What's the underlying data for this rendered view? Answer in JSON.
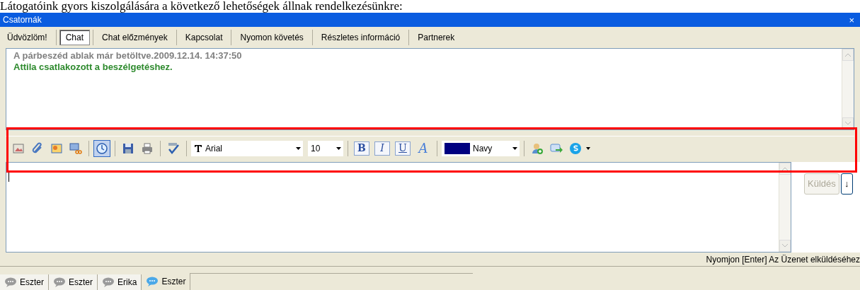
{
  "caption": "Látogatóink gyors kiszolgálására a következő lehetőségek állnak rendelkezésünkre:",
  "window": {
    "title": "Csatornák",
    "close": "×"
  },
  "tabs": [
    {
      "label": "Üdvözlöm!",
      "selected": false
    },
    {
      "label": "Chat",
      "selected": true
    },
    {
      "label": "Chat előzmények",
      "selected": false
    },
    {
      "label": "Kapcsolat",
      "selected": false
    },
    {
      "label": "Nyomon követés",
      "selected": false
    },
    {
      "label": "Részletes információ",
      "selected": false
    },
    {
      "label": "Partnerek",
      "selected": false
    }
  ],
  "messages": [
    {
      "kind": "system",
      "text": "A párbeszéd ablak már betöltve.2009.12.14. 14:37:50"
    },
    {
      "kind": "join",
      "text": "Attila csatlakozott a beszélgetéshez."
    }
  ],
  "toolbar": {
    "icons_left": [
      {
        "kind": "picture",
        "on": false
      },
      {
        "kind": "clip",
        "on": false
      },
      {
        "kind": "image",
        "on": false
      },
      {
        "kind": "cut",
        "on": false
      },
      {
        "kind": "clock",
        "on": true
      },
      {
        "kind": "save",
        "on": false
      },
      {
        "kind": "print",
        "on": false
      },
      {
        "kind": "spell",
        "on": false
      }
    ],
    "font": "Arial",
    "size": "10",
    "format": [
      {
        "kind": "bold",
        "label": "B"
      },
      {
        "kind": "italic",
        "label": "I"
      },
      {
        "kind": "underline",
        "label": "U"
      },
      {
        "kind": "style",
        "label": "A"
      }
    ],
    "color": {
      "name": "Navy",
      "color": "#000080"
    },
    "icons_right": [
      {
        "kind": "person-add",
        "on": false
      },
      {
        "kind": "chat-arrow",
        "on": false
      },
      {
        "kind": "logo",
        "on": false
      }
    ]
  },
  "send": {
    "label": "Küldés",
    "disabled": true,
    "arrow": "↓"
  },
  "status_bar": "Nyomjon [Enter] Az Üzenet elküldéséhez",
  "bottom_tabs": [
    {
      "label": "Eszter",
      "selected": false
    },
    {
      "label": "Eszter",
      "selected": false
    },
    {
      "label": "Erika",
      "selected": false
    },
    {
      "label": "Eszter",
      "selected": true
    }
  ]
}
